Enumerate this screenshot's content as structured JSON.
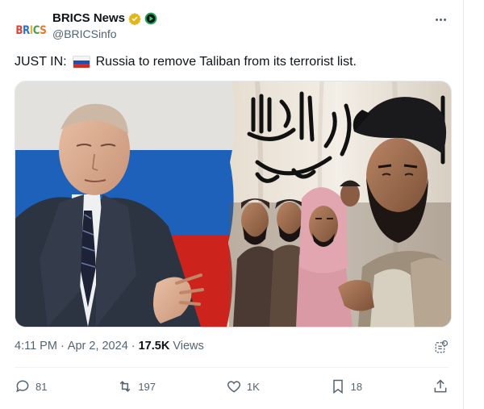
{
  "author": {
    "display_name": "BRICS News",
    "handle": "@BRICSinfo",
    "avatar_text": "BRICS",
    "verified_icon": "gold-verified-badge-icon",
    "affiliate_icon": "green-affiliate-badge-icon"
  },
  "tweet": {
    "text_prefix": "JUST IN:",
    "flag_icon": "russia-flag-emoji",
    "text_body": "Russia to remove Taliban from its terrorist list."
  },
  "meta": {
    "time": "4:11 PM",
    "separator": "·",
    "date": "Apr 2, 2024",
    "views_count": "17.5K",
    "views_label": "Views"
  },
  "actions": {
    "replies": "81",
    "reposts": "197",
    "likes": "1K",
    "bookmarks": "18"
  },
  "media": {
    "flag_arabic_text": "لا إله إلا الله محمد رسول الله",
    "colors": {
      "russia_white": "#f2f2f0",
      "russia_blue": "#1f67c4",
      "russia_red": "#d9251f",
      "taliban_flag": "#efe9df"
    }
  },
  "colors": {
    "verified_gold": "#e2b719",
    "affiliate_green": "#1aa553",
    "muted_text": "#536471"
  }
}
